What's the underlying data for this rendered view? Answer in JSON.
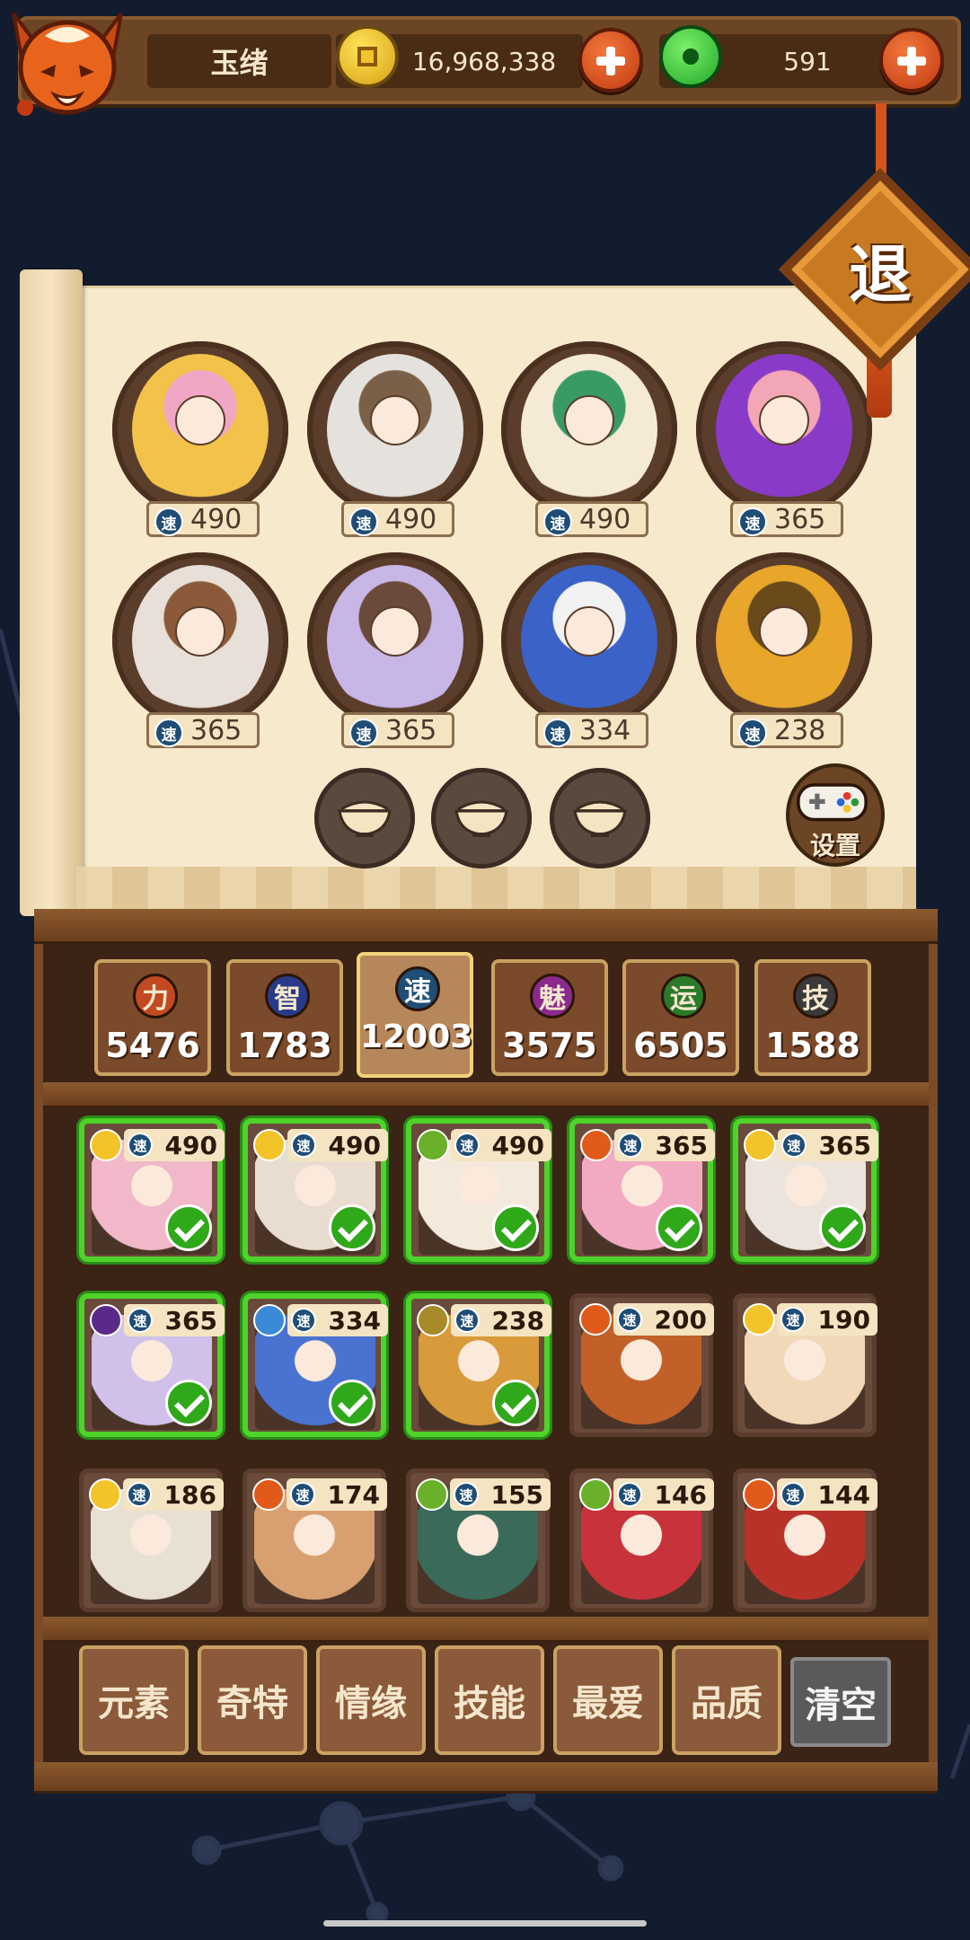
{
  "header": {
    "player_name": "玉绪",
    "coins": "16,968,338",
    "gems": "591",
    "coin_icon": "gold-coin-icon",
    "gem_icon": "jade-gem-icon"
  },
  "exit": {
    "label": "退"
  },
  "team": {
    "slots": [
      {
        "speed": "490",
        "color": "#f3c24a",
        "accent": "#f2a6c6"
      },
      {
        "speed": "490",
        "color": "#e5e2de",
        "accent": "#7a6048"
      },
      {
        "speed": "490",
        "color": "#f5ead6",
        "accent": "#3a9a66"
      },
      {
        "speed": "365",
        "color": "#8a3ac8",
        "accent": "#f2a6b6"
      },
      {
        "speed": "365",
        "color": "#e8e0d8",
        "accent": "#8a5a3a"
      },
      {
        "speed": "365",
        "color": "#c8b6e6",
        "accent": "#6a4a3a"
      },
      {
        "speed": "334",
        "color": "#3a62c8",
        "accent": "#f2f2f2"
      },
      {
        "speed": "238",
        "color": "#e8a62a",
        "accent": "#6a4a1a"
      }
    ],
    "empty_bowls": 3
  },
  "settings": {
    "label": "设置"
  },
  "stats": [
    {
      "label": "力",
      "value": "5476",
      "color": "#c24a22"
    },
    {
      "label": "智",
      "value": "1783",
      "color": "#2a3a8a"
    },
    {
      "label": "速",
      "value": "12003",
      "color": "#1f4d75"
    },
    {
      "label": "魅",
      "value": "3575",
      "color": "#8a2a8a"
    },
    {
      "label": "运",
      "value": "6505",
      "color": "#2a7a2a"
    },
    {
      "label": "技",
      "value": "1588",
      "color": "#3a3a3a"
    }
  ],
  "speed_label": "速",
  "roster": [
    {
      "speed": "490",
      "element": "#f2c42a",
      "selected": true,
      "art": "#f0b8c8"
    },
    {
      "speed": "490",
      "element": "#f2c42a",
      "selected": true,
      "art": "#e8ddd0"
    },
    {
      "speed": "490",
      "element": "#6ab02a",
      "selected": true,
      "art": "#f4eadc"
    },
    {
      "speed": "365",
      "element": "#e25a1a",
      "selected": true,
      "art": "#f2aac2"
    },
    {
      "speed": "365",
      "element": "#f2c42a",
      "selected": true,
      "art": "#ece4dc"
    },
    {
      "speed": "365",
      "element": "#5a2a8a",
      "selected": true,
      "art": "#d0c0ea"
    },
    {
      "speed": "334",
      "element": "#3a8ad8",
      "selected": true,
      "art": "#4a72d0"
    },
    {
      "speed": "238",
      "element": "#a88a2a",
      "selected": true,
      "art": "#d89a3a"
    },
    {
      "speed": "200",
      "element": "#e25a1a",
      "selected": false,
      "art": "#c2602a"
    },
    {
      "speed": "190",
      "element": "#f2c42a",
      "selected": false,
      "art": "#f0d8b8"
    },
    {
      "speed": "186",
      "element": "#f2c42a",
      "selected": false,
      "art": "#e8e0d2"
    },
    {
      "speed": "174",
      "element": "#e25a1a",
      "selected": false,
      "art": "#d8a070"
    },
    {
      "speed": "155",
      "element": "#6ab02a",
      "selected": false,
      "art": "#3a6a5a"
    },
    {
      "speed": "146",
      "element": "#6ab02a",
      "selected": false,
      "art": "#c8323a"
    },
    {
      "speed": "144",
      "element": "#e25a1a",
      "selected": false,
      "art": "#b8322a"
    }
  ],
  "filters": [
    "元素",
    "奇特",
    "情缘",
    "技能",
    "最爱",
    "品质"
  ],
  "clear_label": "清空"
}
